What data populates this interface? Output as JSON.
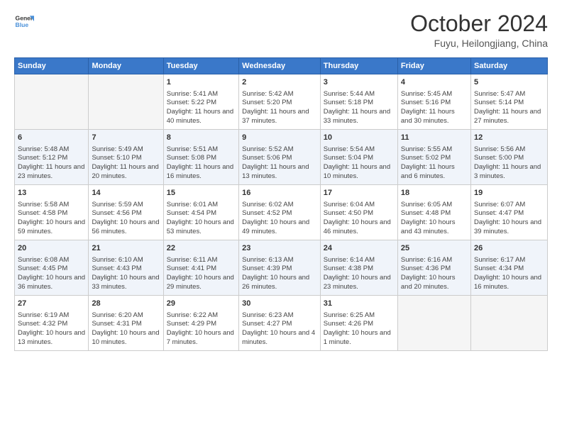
{
  "header": {
    "logo_line1": "General",
    "logo_line2": "Blue",
    "main_title": "October 2024",
    "subtitle": "Fuyu, Heilongjiang, China"
  },
  "columns": [
    "Sunday",
    "Monday",
    "Tuesday",
    "Wednesday",
    "Thursday",
    "Friday",
    "Saturday"
  ],
  "weeks": [
    {
      "shaded": false,
      "days": [
        {
          "num": "",
          "sunrise": "",
          "sunset": "",
          "daylight": ""
        },
        {
          "num": "",
          "sunrise": "",
          "sunset": "",
          "daylight": ""
        },
        {
          "num": "1",
          "sunrise": "Sunrise: 5:41 AM",
          "sunset": "Sunset: 5:22 PM",
          "daylight": "Daylight: 11 hours and 40 minutes."
        },
        {
          "num": "2",
          "sunrise": "Sunrise: 5:42 AM",
          "sunset": "Sunset: 5:20 PM",
          "daylight": "Daylight: 11 hours and 37 minutes."
        },
        {
          "num": "3",
          "sunrise": "Sunrise: 5:44 AM",
          "sunset": "Sunset: 5:18 PM",
          "daylight": "Daylight: 11 hours and 33 minutes."
        },
        {
          "num": "4",
          "sunrise": "Sunrise: 5:45 AM",
          "sunset": "Sunset: 5:16 PM",
          "daylight": "Daylight: 11 hours and 30 minutes."
        },
        {
          "num": "5",
          "sunrise": "Sunrise: 5:47 AM",
          "sunset": "Sunset: 5:14 PM",
          "daylight": "Daylight: 11 hours and 27 minutes."
        }
      ]
    },
    {
      "shaded": true,
      "days": [
        {
          "num": "6",
          "sunrise": "Sunrise: 5:48 AM",
          "sunset": "Sunset: 5:12 PM",
          "daylight": "Daylight: 11 hours and 23 minutes."
        },
        {
          "num": "7",
          "sunrise": "Sunrise: 5:49 AM",
          "sunset": "Sunset: 5:10 PM",
          "daylight": "Daylight: 11 hours and 20 minutes."
        },
        {
          "num": "8",
          "sunrise": "Sunrise: 5:51 AM",
          "sunset": "Sunset: 5:08 PM",
          "daylight": "Daylight: 11 hours and 16 minutes."
        },
        {
          "num": "9",
          "sunrise": "Sunrise: 5:52 AM",
          "sunset": "Sunset: 5:06 PM",
          "daylight": "Daylight: 11 hours and 13 minutes."
        },
        {
          "num": "10",
          "sunrise": "Sunrise: 5:54 AM",
          "sunset": "Sunset: 5:04 PM",
          "daylight": "Daylight: 11 hours and 10 minutes."
        },
        {
          "num": "11",
          "sunrise": "Sunrise: 5:55 AM",
          "sunset": "Sunset: 5:02 PM",
          "daylight": "Daylight: 11 hours and 6 minutes."
        },
        {
          "num": "12",
          "sunrise": "Sunrise: 5:56 AM",
          "sunset": "Sunset: 5:00 PM",
          "daylight": "Daylight: 11 hours and 3 minutes."
        }
      ]
    },
    {
      "shaded": false,
      "days": [
        {
          "num": "13",
          "sunrise": "Sunrise: 5:58 AM",
          "sunset": "Sunset: 4:58 PM",
          "daylight": "Daylight: 10 hours and 59 minutes."
        },
        {
          "num": "14",
          "sunrise": "Sunrise: 5:59 AM",
          "sunset": "Sunset: 4:56 PM",
          "daylight": "Daylight: 10 hours and 56 minutes."
        },
        {
          "num": "15",
          "sunrise": "Sunrise: 6:01 AM",
          "sunset": "Sunset: 4:54 PM",
          "daylight": "Daylight: 10 hours and 53 minutes."
        },
        {
          "num": "16",
          "sunrise": "Sunrise: 6:02 AM",
          "sunset": "Sunset: 4:52 PM",
          "daylight": "Daylight: 10 hours and 49 minutes."
        },
        {
          "num": "17",
          "sunrise": "Sunrise: 6:04 AM",
          "sunset": "Sunset: 4:50 PM",
          "daylight": "Daylight: 10 hours and 46 minutes."
        },
        {
          "num": "18",
          "sunrise": "Sunrise: 6:05 AM",
          "sunset": "Sunset: 4:48 PM",
          "daylight": "Daylight: 10 hours and 43 minutes."
        },
        {
          "num": "19",
          "sunrise": "Sunrise: 6:07 AM",
          "sunset": "Sunset: 4:47 PM",
          "daylight": "Daylight: 10 hours and 39 minutes."
        }
      ]
    },
    {
      "shaded": true,
      "days": [
        {
          "num": "20",
          "sunrise": "Sunrise: 6:08 AM",
          "sunset": "Sunset: 4:45 PM",
          "daylight": "Daylight: 10 hours and 36 minutes."
        },
        {
          "num": "21",
          "sunrise": "Sunrise: 6:10 AM",
          "sunset": "Sunset: 4:43 PM",
          "daylight": "Daylight: 10 hours and 33 minutes."
        },
        {
          "num": "22",
          "sunrise": "Sunrise: 6:11 AM",
          "sunset": "Sunset: 4:41 PM",
          "daylight": "Daylight: 10 hours and 29 minutes."
        },
        {
          "num": "23",
          "sunrise": "Sunrise: 6:13 AM",
          "sunset": "Sunset: 4:39 PM",
          "daylight": "Daylight: 10 hours and 26 minutes."
        },
        {
          "num": "24",
          "sunrise": "Sunrise: 6:14 AM",
          "sunset": "Sunset: 4:38 PM",
          "daylight": "Daylight: 10 hours and 23 minutes."
        },
        {
          "num": "25",
          "sunrise": "Sunrise: 6:16 AM",
          "sunset": "Sunset: 4:36 PM",
          "daylight": "Daylight: 10 hours and 20 minutes."
        },
        {
          "num": "26",
          "sunrise": "Sunrise: 6:17 AM",
          "sunset": "Sunset: 4:34 PM",
          "daylight": "Daylight: 10 hours and 16 minutes."
        }
      ]
    },
    {
      "shaded": false,
      "days": [
        {
          "num": "27",
          "sunrise": "Sunrise: 6:19 AM",
          "sunset": "Sunset: 4:32 PM",
          "daylight": "Daylight: 10 hours and 13 minutes."
        },
        {
          "num": "28",
          "sunrise": "Sunrise: 6:20 AM",
          "sunset": "Sunset: 4:31 PM",
          "daylight": "Daylight: 10 hours and 10 minutes."
        },
        {
          "num": "29",
          "sunrise": "Sunrise: 6:22 AM",
          "sunset": "Sunset: 4:29 PM",
          "daylight": "Daylight: 10 hours and 7 minutes."
        },
        {
          "num": "30",
          "sunrise": "Sunrise: 6:23 AM",
          "sunset": "Sunset: 4:27 PM",
          "daylight": "Daylight: 10 hours and 4 minutes."
        },
        {
          "num": "31",
          "sunrise": "Sunrise: 6:25 AM",
          "sunset": "Sunset: 4:26 PM",
          "daylight": "Daylight: 10 hours and 1 minute."
        },
        {
          "num": "",
          "sunrise": "",
          "sunset": "",
          "daylight": ""
        },
        {
          "num": "",
          "sunrise": "",
          "sunset": "",
          "daylight": ""
        }
      ]
    }
  ]
}
